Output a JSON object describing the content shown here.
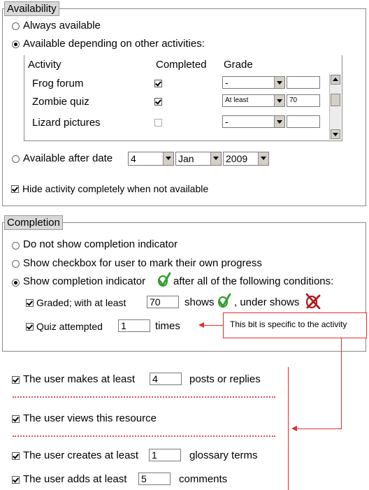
{
  "availability": {
    "legend": "Availability",
    "always": "Always available",
    "depending": "Available depending on other activities:",
    "table": {
      "headers": [
        "Activity",
        "Completed",
        "Grade"
      ],
      "rows": [
        {
          "activity": "Frog forum",
          "completed": true,
          "grade_op": "-",
          "grade_val": ""
        },
        {
          "activity": "Zombie quiz",
          "completed": true,
          "grade_op": "At least",
          "grade_val": "70"
        },
        {
          "activity": "Lizard pictures",
          "completed": false,
          "grade_op": "-",
          "grade_val": ""
        }
      ]
    },
    "after_date": "Available after date",
    "date": {
      "day": "4",
      "month": "Jan",
      "year": "2009"
    },
    "hide": "Hide activity completely when not available"
  },
  "completion": {
    "legend": "Completion",
    "opt_none": "Do not show completion indicator",
    "opt_checkbox": "Show checkbox for user to mark their own progress",
    "opt_show": "Show completion indicator",
    "opt_show_suffix": "after all of the following conditions:",
    "graded_label": "Graded; with at least",
    "graded_value": "70",
    "shows": "shows",
    "under_shows": ", under shows",
    "quiz_label": "Quiz attempted",
    "quiz_value": "1",
    "times": "times"
  },
  "callout": "This bit is specific to the activity",
  "extras": [
    {
      "label": "The user makes at least",
      "value": "4",
      "suffix": "posts or replies"
    },
    {
      "label": "The user views this resource"
    },
    {
      "label": "The user creates at least",
      "value": "1",
      "suffix": "glossary terms"
    },
    {
      "label": "The user adds at least",
      "value": "5",
      "suffix": "comments"
    }
  ],
  "colors": {
    "tick": "#2e9e2e",
    "cross": "#b01818",
    "annotation": "#e03030"
  }
}
